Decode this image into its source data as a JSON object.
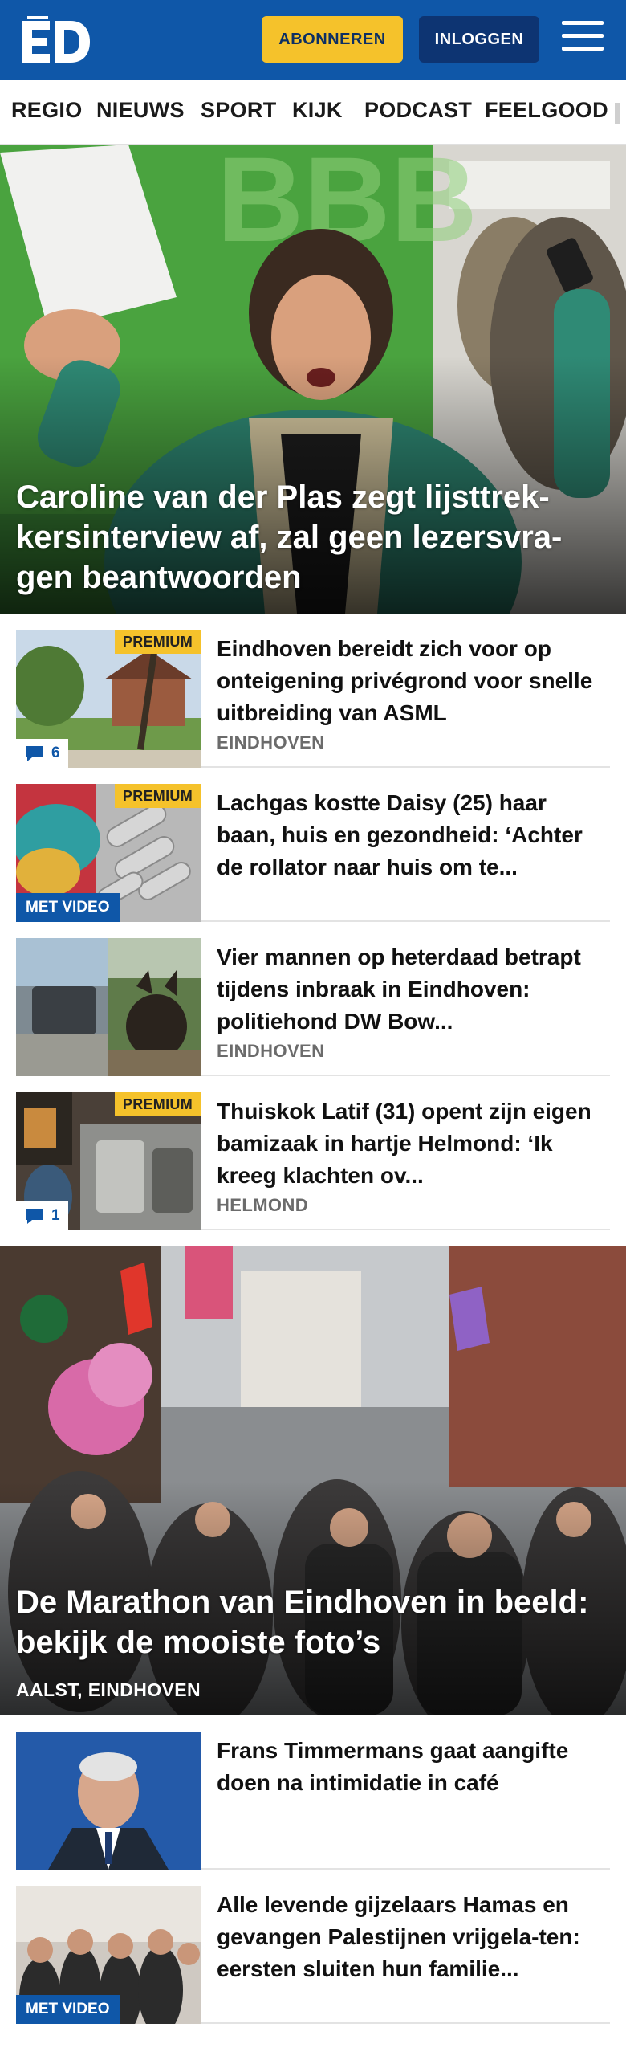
{
  "header": {
    "logo_text": "ED",
    "subscribe_label": "ABONNEREN",
    "login_label": "INLOGGEN",
    "menu_icon": "hamburger-icon",
    "brand_color": "#0f57a8",
    "accent_color": "#f5c22b"
  },
  "nav": {
    "items": [
      "REGIO",
      "NIEUWS",
      "SPORT",
      "KIJK",
      "PODCAST",
      "FEELGOOD"
    ]
  },
  "hero": {
    "title": "Caroline van der Plas zegt lijsttrek-kersinterview af, zal geen lezersvra-gen beantwoorden"
  },
  "articles": [
    {
      "title": "Eindhoven bereidt zich voor op onteigening privégrond voor snelle uitbreiding van ASML",
      "location": "EINDHOVEN",
      "premium": "PREMIUM",
      "comments": "6"
    },
    {
      "title": "Lachgas kostte Daisy (25) haar baan, huis en gezondheid: ‘Achter de rollator naar huis om te...",
      "premium": "PREMIUM",
      "video": "MET VIDEO"
    },
    {
      "title": "Vier mannen op heterdaad betrapt tijdens inbraak in Eindhoven: politiehond DW Bow...",
      "location": "EINDHOVEN"
    },
    {
      "title": "Thuiskok Latif (31) opent zijn eigen bamizaak in hartje Helmond: ‘Ik kreeg klachten ov...",
      "location": "HELMOND",
      "premium": "PREMIUM",
      "comments": "1"
    }
  ],
  "feature": {
    "title": "De Marathon van Eindhoven in beeld: bekijk de mooiste foto’s",
    "location": "AALST, EINDHOVEN"
  },
  "articles_lower": [
    {
      "title": "Frans Timmermans gaat aangifte doen na intimidatie in café"
    },
    {
      "title": "Alle levende gijzelaars Hamas en gevangen Palestijnen vrijgela-ten: eersten sluiten hun familie...",
      "video": "MET VIDEO"
    }
  ]
}
